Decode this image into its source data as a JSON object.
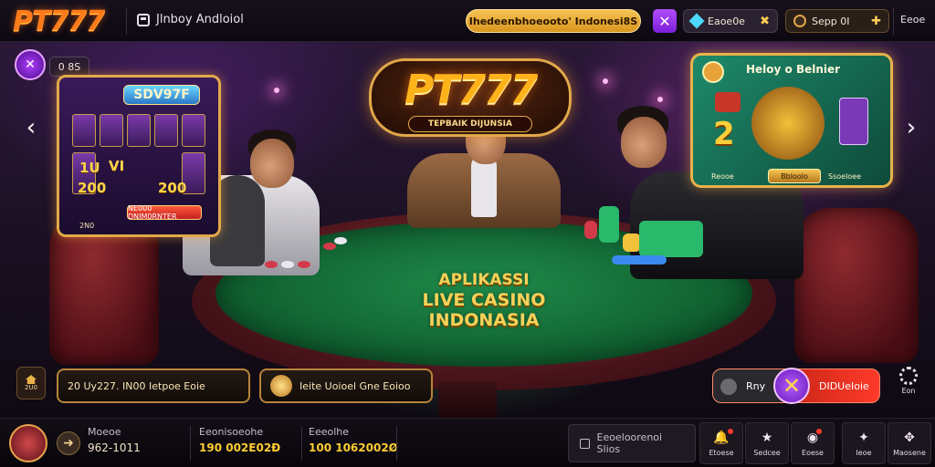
{
  "topbar": {
    "logo": "PT777",
    "apps_link": "Jlnboy Andloiol",
    "promo": "Ihedeenbhoeooto'  Indonesi8S",
    "diamond_label": "Eaoe0e",
    "sep_label": "Sepp 0I",
    "right_label": "Eeoe"
  },
  "hero": {
    "mini_label": "0 8S",
    "slot": {
      "title": "SDV97F",
      "values": [
        "1U",
        "VI",
        "200",
        "200"
      ],
      "button": "NE000 DNIM0RNTER",
      "footer": "2N0"
    },
    "logo": {
      "title": "PT777",
      "subtitle": "TEPBAIK DIJUNSIA"
    },
    "felt_text": [
      "APLIKASSI",
      "LIVE CASINO",
      "INDONASIA"
    ],
    "right_panel": {
      "title": "Heloy o Belnier",
      "number": "2",
      "left": "Reooe",
      "button": "Bbloolo",
      "right": "Ssoeloee"
    },
    "actions": {
      "home_label": "2U0",
      "left_pill": "20  Uy227.  IN00 Ietpoe Eoie",
      "mid_pill": "Ieite Uoioel Gne Eoioo",
      "right_left": "Rny",
      "right_right": "DIDUeIoie",
      "gear_label": "Eon"
    }
  },
  "bottombar": {
    "stat1": {
      "label": "Moeoe",
      "value": "962-1011"
    },
    "stat2": {
      "label": "Eeonisoeohe",
      "value": "190 002E02Đ"
    },
    "stat3": {
      "label": "Eeeolhe",
      "value": "100 1062002Ø"
    },
    "search_placeholder": "Eeoeloorenoi Slios",
    "nav": [
      {
        "label": "Etoese",
        "icon": "bell-icon"
      },
      {
        "label": "Sedcee",
        "icon": "star-icon"
      },
      {
        "label": "Eoese",
        "icon": "chat-icon"
      },
      {
        "label": "Ieoe",
        "icon": "sparkle-icon"
      },
      {
        "label": "Maosene",
        "icon": "grid-icon"
      }
    ]
  },
  "colors": {
    "brand_orange": "#ff7a1a",
    "gold": "#e2a84a",
    "felt_green": "#1f8a4a",
    "accent_purple": "#b34dff",
    "alert_red": "#ff3a2a"
  }
}
